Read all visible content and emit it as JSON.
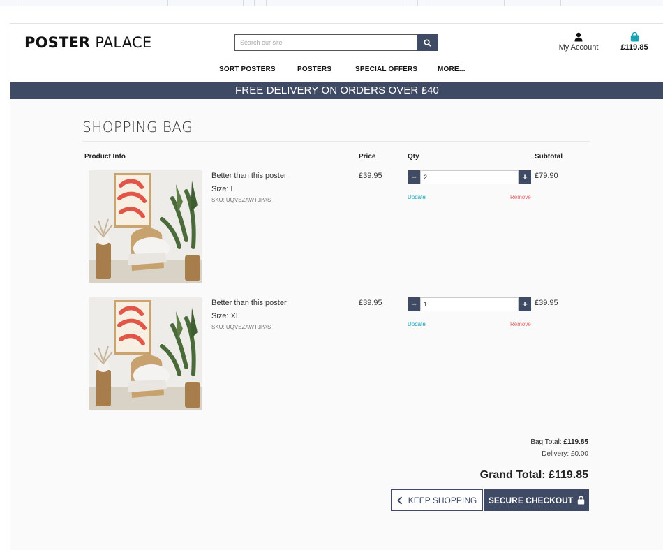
{
  "colors": {
    "accent": "#3f4a64",
    "update_link": "#1a9fb5",
    "remove_link": "#e06a6a",
    "bag_icon": "#17a2b8"
  },
  "header": {
    "logo_bold": "POSTER",
    "logo_light": "PALACE",
    "search_placeholder": "Search our site",
    "search_icon": "search-icon",
    "account_label": "My Account",
    "account_icon": "user-icon",
    "bag_total": "£119.85",
    "bag_icon": "shopping-bag-icon"
  },
  "nav": {
    "items": [
      "SORT POSTERS",
      "POSTERS",
      "SPECIAL OFFERS",
      "MORE..."
    ]
  },
  "banner": {
    "text": "FREE DELIVERY ON ORDERS OVER £40"
  },
  "bag": {
    "title": "SHOPPING BAG",
    "headers": {
      "product": "Product Info",
      "price": "Price",
      "qty": "Qty",
      "subtotal": "Subtotal"
    },
    "items": [
      {
        "name": "Better than this poster",
        "size": "Size: L",
        "sku": "SKU: UQVEZAWTJPAS",
        "price": "£39.95",
        "qty": "2",
        "subtotal": "£79.90",
        "update": "Update",
        "remove": "Remove"
      },
      {
        "name": "Better than this poster",
        "size": "Size: XL",
        "sku": "SKU: UQVEZAWTJPAS",
        "price": "£39.95",
        "qty": "1",
        "subtotal": "£39.95",
        "update": "Update",
        "remove": "Remove"
      }
    ]
  },
  "summary": {
    "bag_total_label": "Bag Total:",
    "bag_total_value": "£119.85",
    "delivery": "Delivery: £0.00",
    "grand_total": "Grand Total: £119.85"
  },
  "actions": {
    "keep_shopping": "KEEP SHOPPING",
    "secure_checkout": "SECURE CHECKOUT",
    "minus": "−",
    "plus": "+"
  }
}
